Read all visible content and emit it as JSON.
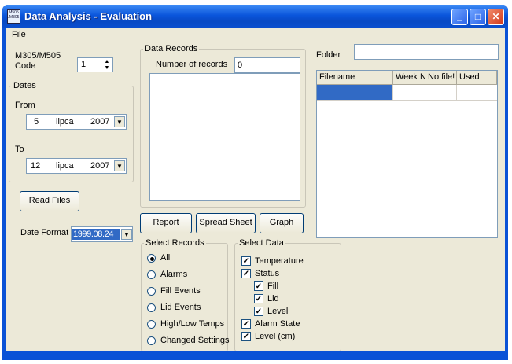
{
  "window": {
    "title": "Data Analysis - Evaluation",
    "icon_text": "M505 /M305"
  },
  "menu": {
    "file": "File"
  },
  "code": {
    "label_line1": "M305/M505",
    "label_line2": "Code",
    "value": "1"
  },
  "dates": {
    "legend": "Dates",
    "from": {
      "label": "From",
      "day": "5",
      "month": "lipca",
      "year": "2007"
    },
    "to": {
      "label": "To",
      "day": "12",
      "month": "lipca",
      "year": "2007"
    }
  },
  "read_files_button": "Read Files",
  "date_format": {
    "label": "Date Format",
    "value": "1999.08.24"
  },
  "data_records": {
    "legend": "Data Records",
    "count_label": "Number of records",
    "count_value": "0"
  },
  "buttons": {
    "report": "Report",
    "spreadsheet": "Spread Sheet",
    "graph": "Graph"
  },
  "folder": {
    "label": "Folder",
    "value": ""
  },
  "file_table": {
    "columns": [
      "Filename",
      "Week N",
      "No file!",
      "Used"
    ]
  },
  "select_records": {
    "legend": "Select Records",
    "options": [
      "All",
      "Alarms",
      "Fill Events",
      "Lid Events",
      "High/Low Temps",
      "Changed Settings"
    ],
    "selected": "All"
  },
  "select_data": {
    "legend": "Select Data",
    "temperature": "Temperature",
    "status": "Status",
    "fill": "Fill",
    "lid": "Lid",
    "level": "Level",
    "alarm_state": "Alarm State",
    "level_cm": "Level (cm)"
  },
  "colors": {
    "title_bar": "#0a55db",
    "face": "#ece9d8",
    "selection": "#316ac5"
  }
}
